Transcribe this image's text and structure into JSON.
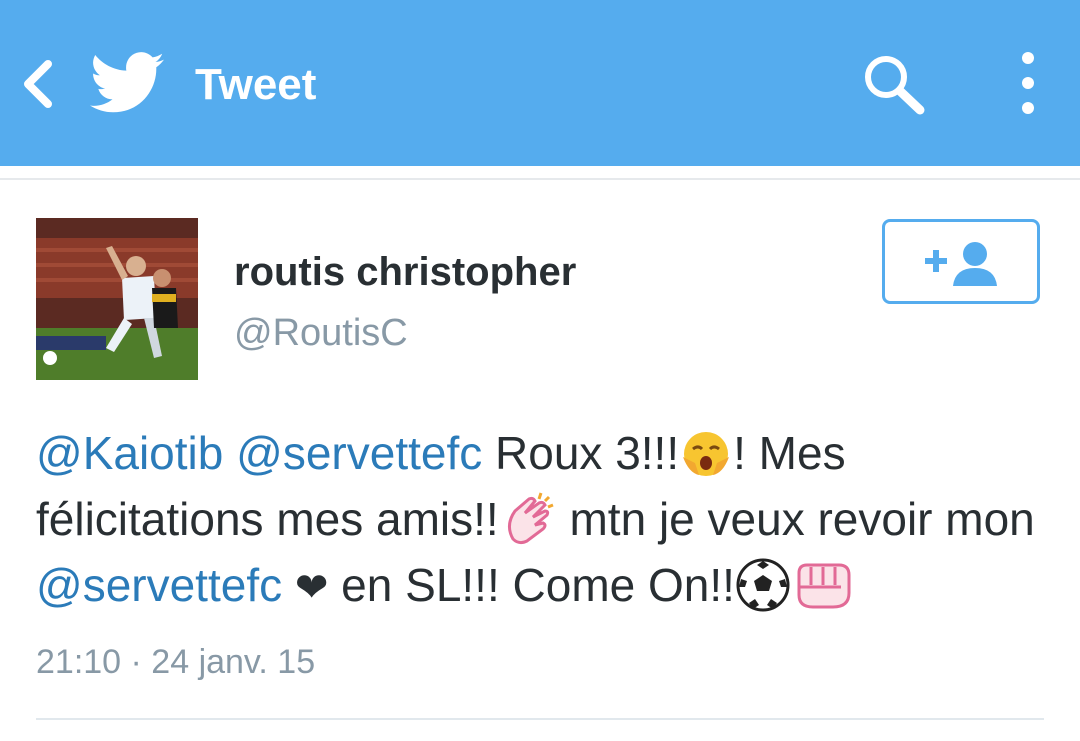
{
  "appbar": {
    "title": "Tweet",
    "back_icon": "chevron-left-icon",
    "logo_icon": "twitter-bird-icon",
    "search_icon": "search-icon",
    "menu_icon": "overflow-menu-icon",
    "color": "#55acee"
  },
  "tweet": {
    "author": {
      "name": "routis christopher",
      "handle": "@RoutisC"
    },
    "follow_icon": "add-user-icon",
    "text": {
      "mention1": "@Kaiotib",
      "mention2": "@servettefc",
      "part1": " Roux 3!!!",
      "part2": "! Mes félicitations mes amis!!",
      "part3": " mtn je veux revoir mon ",
      "mention3": "@servettefc",
      "part4": " en SL!!! Come On!!"
    },
    "emojis": [
      "crying-face-emoji",
      "clapping-hands-emoji",
      "heart-icon",
      "soccer-ball-emoji",
      "fist-emoji"
    ],
    "heart": "❤",
    "timestamp": "21:10 · 24 janv. 15"
  },
  "colors": {
    "link": "#2b7bb9",
    "text": "#292f33",
    "muted": "#8899a6"
  }
}
